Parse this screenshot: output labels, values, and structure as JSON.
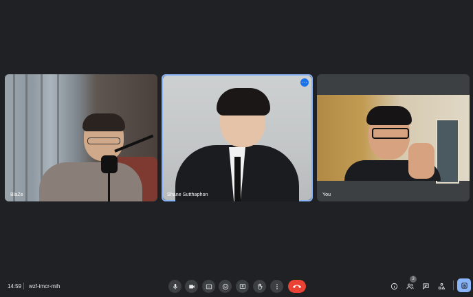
{
  "participants": [
    {
      "name": "BlaZe"
    },
    {
      "name": "Shane Sutthaphon",
      "more_icon": "more-vert-icon"
    },
    {
      "name": "You"
    }
  ],
  "bottom_bar": {
    "time": "14:59",
    "meeting_code": "wzf-imcr-mih",
    "controls": [
      "mic-icon",
      "camera-icon",
      "captions-icon",
      "emoji-icon",
      "present-icon",
      "raise-hand-icon",
      "more-options-icon",
      "end-call-icon"
    ],
    "right_controls": [
      "info-icon",
      "people-icon",
      "chat-icon",
      "activities-icon",
      "host-controls-icon"
    ],
    "people_count": "3"
  },
  "colors": {
    "background": "#202124",
    "tile": "#3c4043",
    "active_border": "#8ab4f8",
    "end_call": "#ea4335",
    "accent_blue": "#1a73e8"
  }
}
